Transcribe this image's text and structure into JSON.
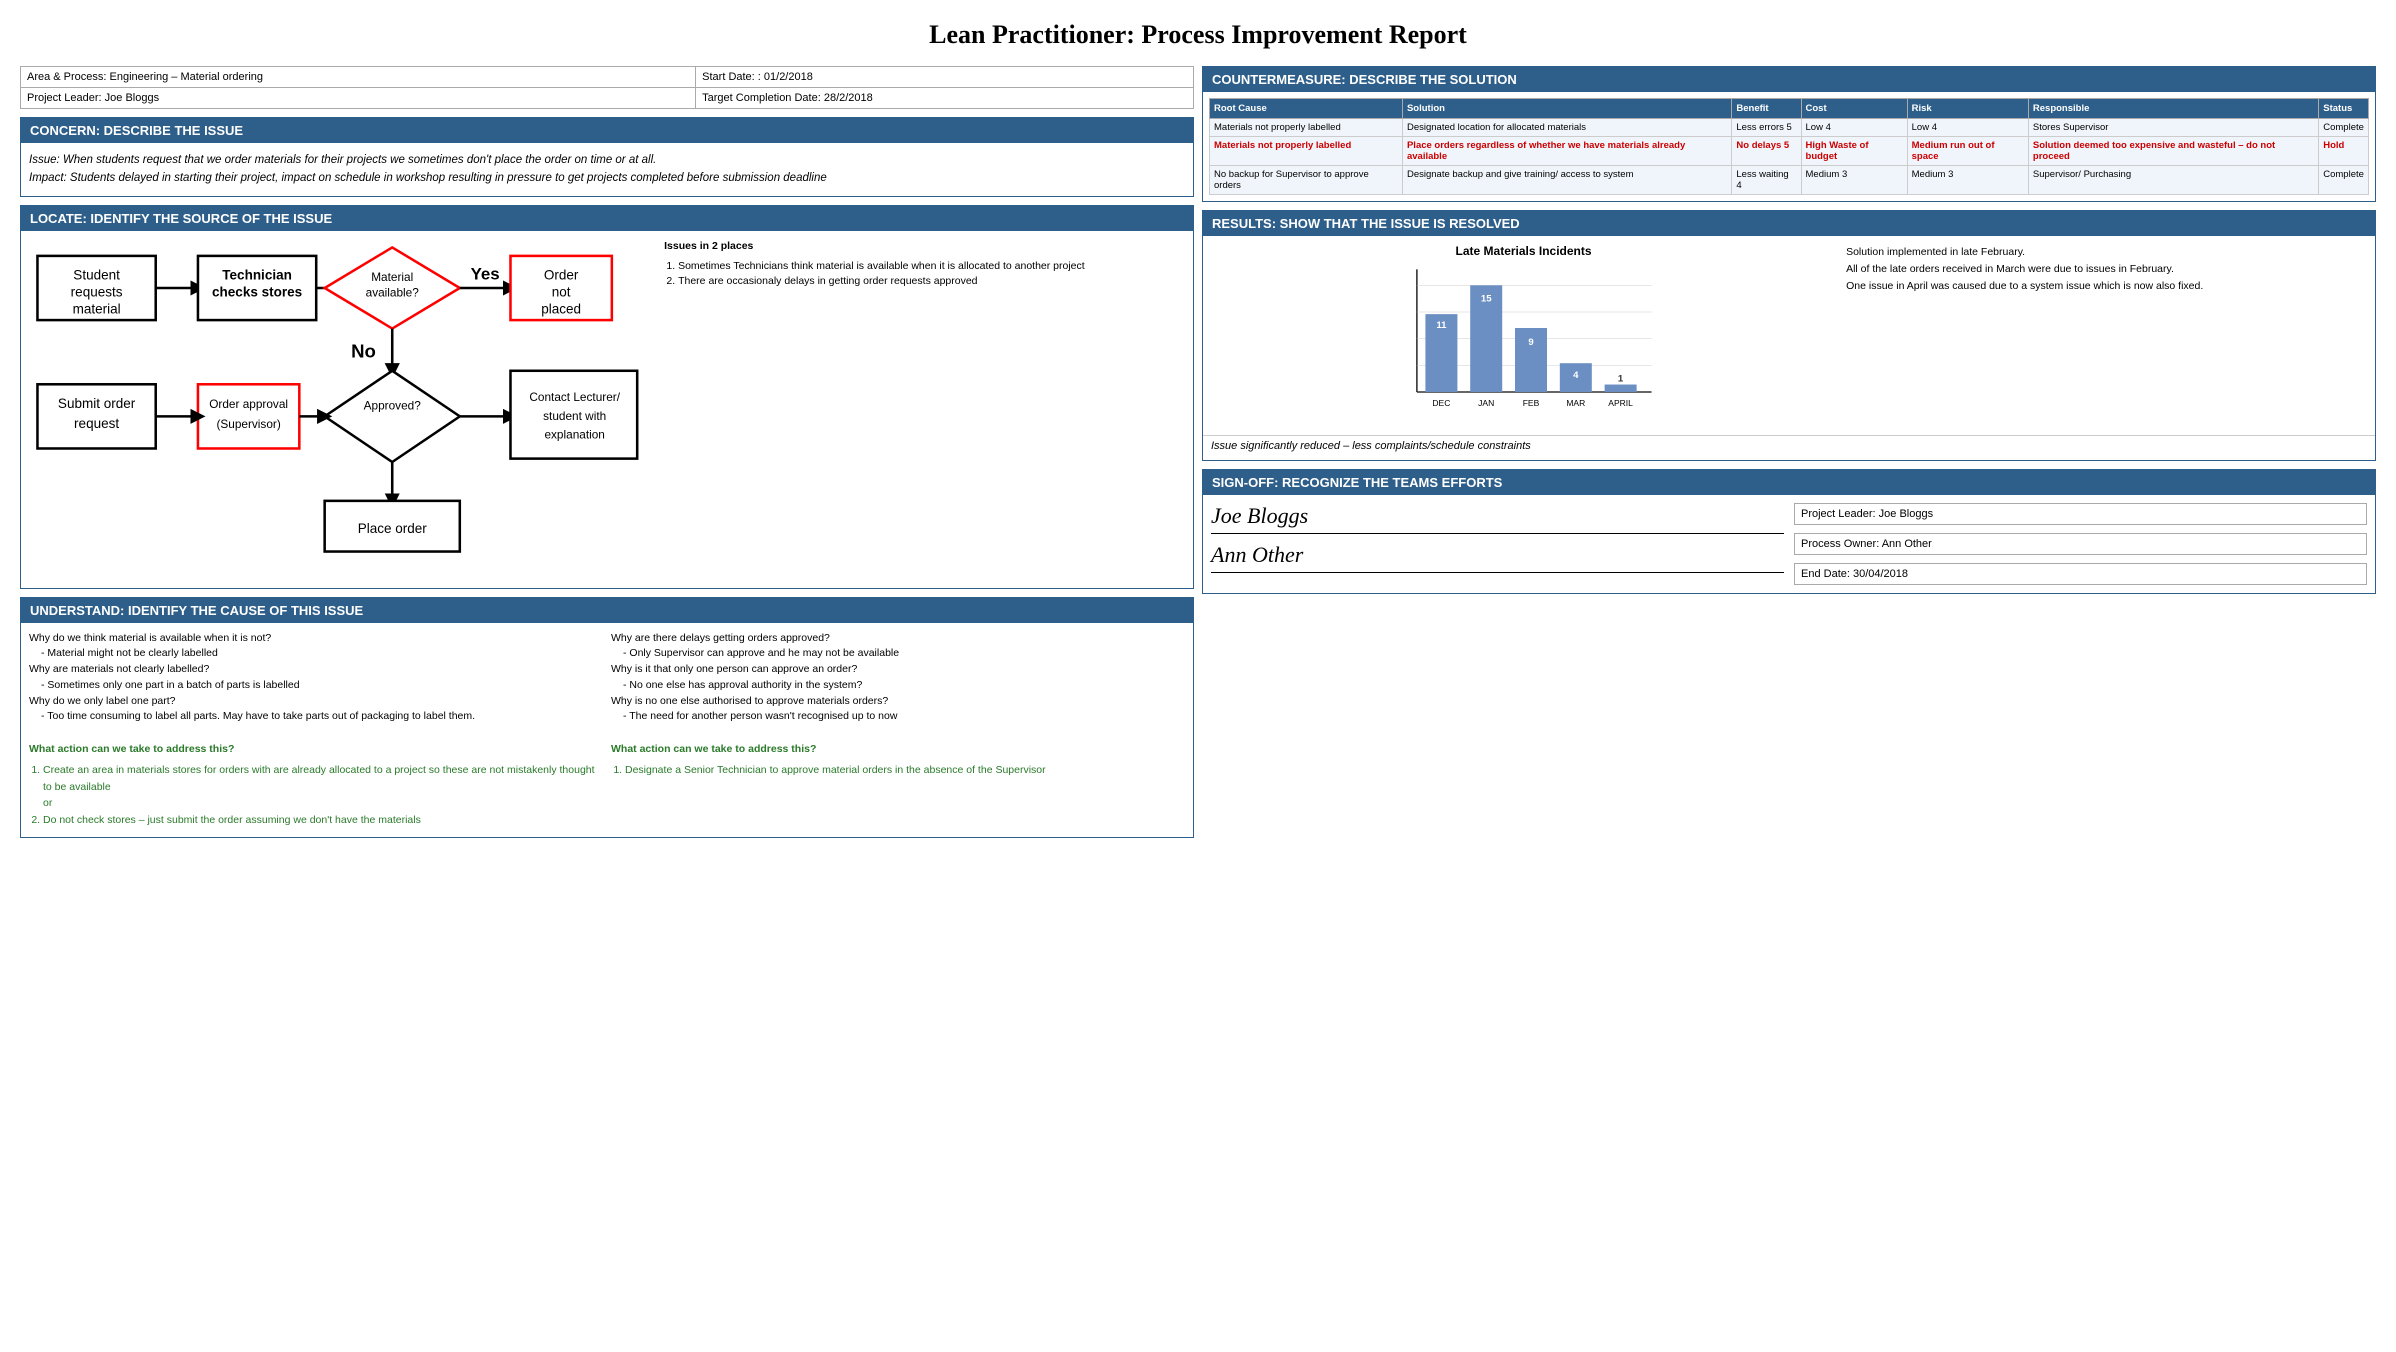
{
  "title": "Lean Practitioner: Process Improvement Report",
  "meta": {
    "area_label": "Area & Process: Engineering – Material ordering",
    "start_label": "Start Date: : 01/2/2018",
    "leader_label": "Project Leader: Joe Bloggs",
    "target_label": "Target Completion Date: 28/2/2018"
  },
  "concern": {
    "header": "CONCERN: DESCRIBE THE ISSUE",
    "text": "Issue: When students request that we order materials for their projects we sometimes don't place the order on time or at all.\nImpact:  Students delayed in starting their project, impact on schedule in workshop resulting in pressure to get projects completed before submission deadline"
  },
  "locate": {
    "header": "LOCATE: IDENTIFY THE SOURCE OF THE ISSUE",
    "issues_header": "Issues in 2 places",
    "issue1": "Sometimes Technicians think material is available when it is allocated to another project",
    "issue2": "There are occasionaly delays in getting order requests approved"
  },
  "understand": {
    "header": "UNDERSTAND: IDENTIFY THE CAUSE OF THIS ISSUE",
    "left_questions": [
      "Why do we think material is available when it is not?",
      " - Material might not be clearly labelled",
      "Why are materials not clearly labelled?",
      " - Sometimes only one part in a batch of parts is labelled",
      "Why do we only label one part?",
      " - Too time consuming to label all parts. May have to take parts out of packaging to label them."
    ],
    "right_questions": [
      "Why are there delays getting orders approved?",
      " - Only Supervisor can approve and he may not be available",
      "Why is it that only one person can approve an order?",
      " - No one else has approval authority in the system?",
      "Why is no one else authorised to approve materials orders?",
      " - The need for another person wasn't recognised up to now"
    ],
    "action_header": "What action can we take to address this?",
    "actions": [
      "Create an area in materials stores for orders with are already allocated to a project so these are not mistakenly thought to be available",
      "or",
      "Do not check stores – just submit the order assuming we don't have the materials"
    ],
    "action2_header": "What action can we take to address this?",
    "actions2": [
      "Designate a Senior Technician to approve material orders in the absence of the Supervisor"
    ]
  },
  "countermeasure": {
    "header": "COUNTERMEASURE: DESCRIBE THE SOLUTION",
    "columns": [
      "Root Cause",
      "Solution",
      "Benefit",
      "Cost",
      "Risk",
      "Responsible",
      "Status"
    ],
    "rows": [
      {
        "root_cause": "Materials not properly labelled",
        "solution": "Designated location for allocated materials",
        "benefit": "Less errors\n5",
        "cost": "Low\n4",
        "risk": "Low\n4",
        "responsible": "Stores Supervisor",
        "status": "Complete",
        "highlight": false
      },
      {
        "root_cause": "Materials not properly labelled",
        "solution": "Place orders regardless of whether we have materials already available",
        "benefit": "No delays\n5",
        "cost": "High\nWaste of budget",
        "risk": "Medium\nrun out of space",
        "responsible": "Solution deemed too expensive and wasteful – do not proceed",
        "status": "Hold",
        "highlight": true
      },
      {
        "root_cause": "No backup for Supervisor to approve orders",
        "solution": "Designate backup and give training/ access to system",
        "benefit": "Less waiting\n4",
        "cost": "Medium\n3",
        "risk": "Medium\n3",
        "responsible": "Supervisor/\nPurchasing",
        "status": "Complete",
        "highlight": false
      }
    ]
  },
  "results": {
    "header": "RESULTS: SHOW THAT THE ISSUE IS RESOLVED",
    "chart_title": "Late Materials Incidents",
    "bars": [
      {
        "label": "DEC",
        "value": 11,
        "height_pct": 73
      },
      {
        "label": "JAN",
        "value": 15,
        "height_pct": 100
      },
      {
        "label": "FEB",
        "value": 9,
        "height_pct": 60
      },
      {
        "label": "MAR",
        "value": 4,
        "height_pct": 27
      },
      {
        "label": "APRIL",
        "value": 1,
        "height_pct": 7
      }
    ],
    "note": "Solution implemented in late February.\nAll of the late orders received in March were due to issues in February.\nOne issue in April was caused due to a system issue which is now also fixed.",
    "summary": "Issue significantly reduced – less complaints/schedule constraints"
  },
  "signoff": {
    "header": "SIGN-OFF: RECOGNIZE THE TEAMS EFFORTS",
    "sig1": "Joe Bloggs",
    "sig2": "Ann Other",
    "field1": "Project Leader: Joe Bloggs",
    "field2": "Process Owner: Ann Other",
    "field3": "End Date: 30/04/2018"
  }
}
